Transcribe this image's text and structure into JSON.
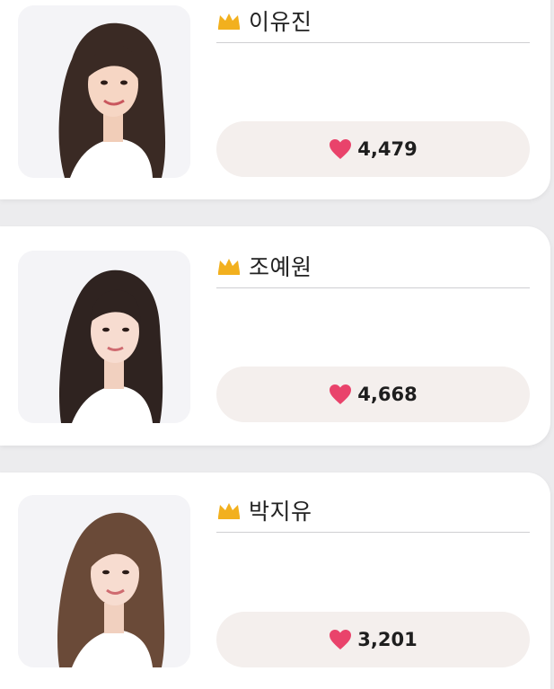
{
  "colors": {
    "heart": "#e9436b",
    "crown": "#f2b01e",
    "vote_button_bg": "#f4efed",
    "background": "#ececee"
  },
  "candidates": [
    {
      "name": "이유진",
      "votes": "4,479",
      "crown_icon": "crown-icon",
      "heart_icon": "heart-icon"
    },
    {
      "name": "조예원",
      "votes": "4,668",
      "crown_icon": "crown-icon",
      "heart_icon": "heart-icon"
    },
    {
      "name": "박지유",
      "votes": "3,201",
      "crown_icon": "crown-icon",
      "heart_icon": "heart-icon"
    }
  ]
}
